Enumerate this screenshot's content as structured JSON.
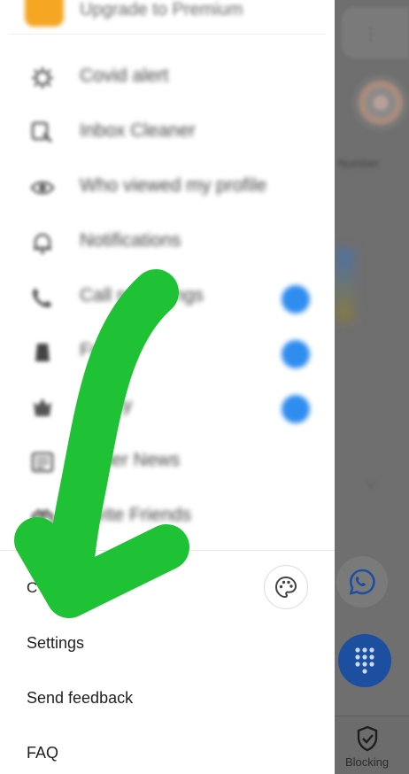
{
  "drawer": {
    "premium_label": "Upgrade to Premium",
    "blurred_items": [
      {
        "label": "Covid alert",
        "icon": "virus-icon",
        "badge": false
      },
      {
        "label": "Inbox Cleaner",
        "icon": "inbox-cleaner-icon",
        "badge": false
      },
      {
        "label": "Who viewed my profile",
        "icon": "eye-icon",
        "badge": false
      },
      {
        "label": "Notifications",
        "icon": "bell-icon",
        "badge": false
      },
      {
        "label": "Call recordings",
        "icon": "call-recording-icon",
        "badge": true
      },
      {
        "label": "Fraud",
        "icon": "fraud-icon",
        "badge": true
      },
      {
        "label": "Safety",
        "icon": "shield-icon",
        "badge": true
      },
      {
        "label": "Caller News",
        "icon": "news-icon",
        "badge": false
      },
      {
        "label": "Invite Friends",
        "icon": "invite-icon",
        "badge": false
      }
    ],
    "theme_label": "C",
    "settings_label": "Settings",
    "feedback_label": "Send feedback",
    "faq_label": "FAQ"
  },
  "background": {
    "contact_name_line1": "",
    "contact_name_line2": "Number",
    "bottom_tab_label": "Blocking"
  },
  "colors": {
    "badge_blue": "#2f8df0",
    "arrow_green": "#1ec234",
    "fab_blue": "#1c4fa0"
  }
}
